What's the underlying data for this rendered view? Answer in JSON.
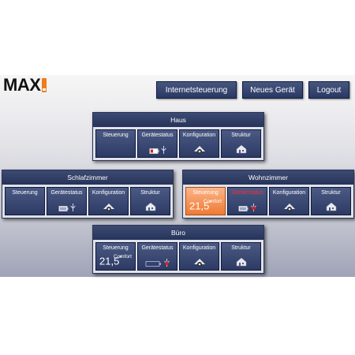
{
  "logo": {
    "text": "MAX"
  },
  "header": {
    "internet_label": "Internetsteuerung",
    "new_device_label": "Neues Gerät",
    "logout_label": "Logout"
  },
  "tile_labels": {
    "control": "Steuerung",
    "status": "Gerätestatus",
    "config": "Konfiguration",
    "structure": "Struktur"
  },
  "rooms": {
    "haus": {
      "name": "Haus"
    },
    "schlafzimmer": {
      "name": "Schlafzimmer"
    },
    "wohnzimmer": {
      "name": "Wohnzimmer",
      "temp": "21,5",
      "unit": "°",
      "mode": "Comfort"
    },
    "buero": {
      "name": "Büro",
      "temp": "21,5",
      "unit": "°",
      "mode": "Comfort"
    }
  },
  "colors": {
    "accent": "#f07c1a",
    "panel_dark": "#2c3a64",
    "alert": "#ff2a2a"
  }
}
